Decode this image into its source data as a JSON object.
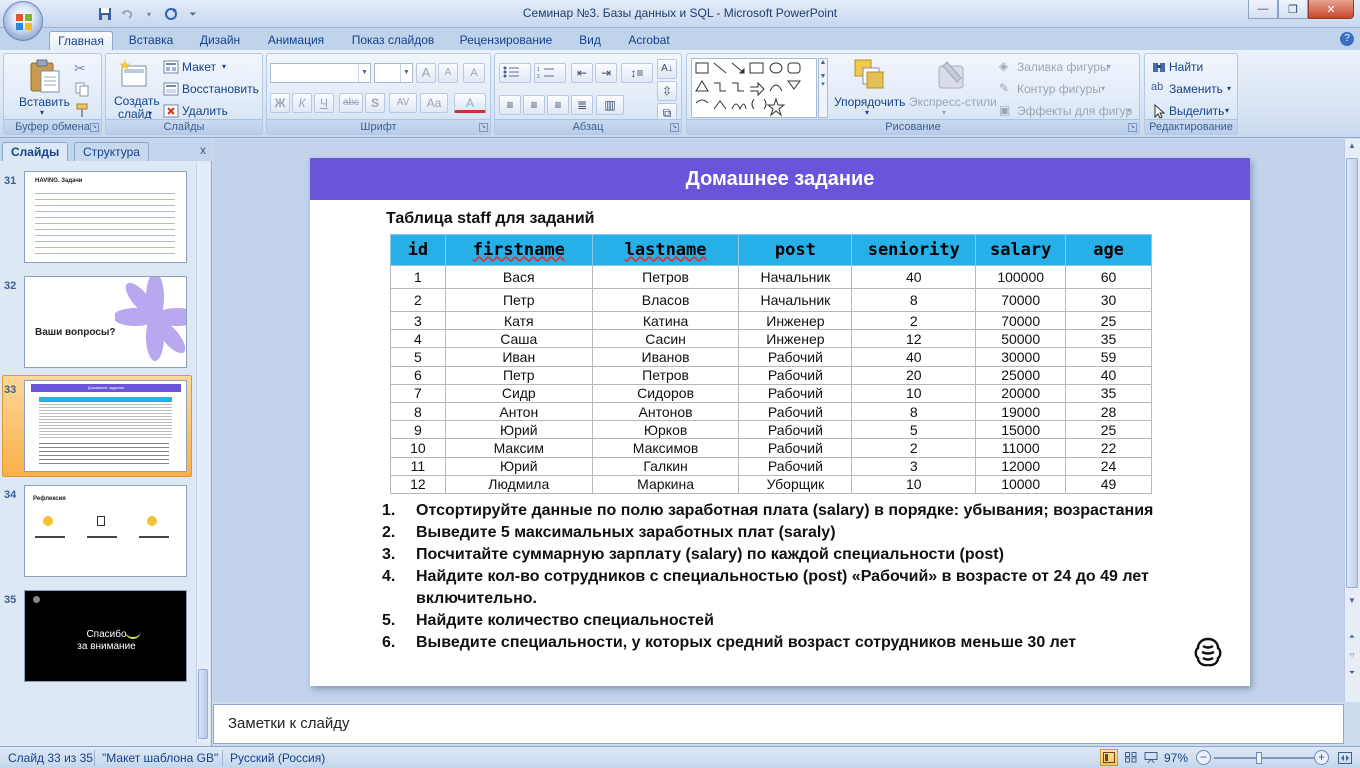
{
  "window": {
    "title": "Семинар №3. Базы данных и SQL - Microsoft PowerPoint",
    "close_label": "✕",
    "minimize_label": "—",
    "restore_label": "❐"
  },
  "ribbon": {
    "tabs": [
      "Главная",
      "Вставка",
      "Дизайн",
      "Анимация",
      "Показ слайдов",
      "Рецензирование",
      "Вид",
      "Acrobat"
    ],
    "active_tab": "Главная",
    "groups": {
      "clipboard": {
        "label": "Буфер обмена",
        "paste": "Вставить"
      },
      "slides": {
        "label": "Слайды",
        "new_slide_1": "Создать",
        "new_slide_2": "слайд",
        "layout": "Макет",
        "reset": "Восстановить",
        "delete": "Удалить"
      },
      "font": {
        "label": "Шрифт",
        "grow": "A",
        "shrink": "A",
        "clear": "A",
        "bold": "Ж",
        "italic": "К",
        "underline": "Ч",
        "strike": "abc",
        "shadow": "S",
        "spacing": "AV",
        "case": "Aa",
        "color": "A"
      },
      "paragraph": {
        "label": "Абзац"
      },
      "drawing": {
        "label": "Рисование",
        "arrange": "Упорядочить",
        "quick_styles": "Экспресс-стили",
        "fill": "Заливка фигуры",
        "outline": "Контур фигуры",
        "effects": "Эффекты для фигур"
      },
      "editing": {
        "label": "Редактирование",
        "find": "Найти",
        "replace": "Заменить",
        "select": "Выделить"
      }
    }
  },
  "left_pane": {
    "tab_slides": "Слайды",
    "tab_outline": "Структура",
    "close": "x",
    "thumbnails": [
      {
        "num": "31",
        "title": "HAVING. Задачи"
      },
      {
        "num": "32",
        "title": "Ваши вопросы?"
      },
      {
        "num": "33",
        "title": "Домашнее задание"
      },
      {
        "num": "34",
        "title": "Рефлексия"
      },
      {
        "num": "35",
        "title_1": "Спасибо",
        "title_2": "за внимание"
      }
    ]
  },
  "slide": {
    "header": "Домашнее задание",
    "caption": "Таблица staff для заданий",
    "columns": [
      "id",
      "firstname",
      "lastname",
      "post",
      "seniority",
      "salary",
      "age"
    ],
    "rows": [
      [
        "1",
        "Вася",
        "Петров",
        "Начальник",
        "40",
        "100000",
        "60"
      ],
      [
        "2",
        "Петр",
        "Власов",
        "Начальник",
        "8",
        "70000",
        "30"
      ],
      [
        "3",
        "Катя",
        "Катина",
        "Инженер",
        "2",
        "70000",
        "25"
      ],
      [
        "4",
        "Саша",
        "Сасин",
        "Инженер",
        "12",
        "50000",
        "35"
      ],
      [
        "5",
        "Иван",
        "Иванов",
        "Рабочий",
        "40",
        "30000",
        "59"
      ],
      [
        "6",
        "Петр",
        "Петров",
        "Рабочий",
        "20",
        "25000",
        "40"
      ],
      [
        "7",
        "Сидр",
        "Сидоров",
        "Рабочий",
        "10",
        "20000",
        "35"
      ],
      [
        "8",
        "Антон",
        "Антонов",
        "Рабочий",
        "8",
        "19000",
        "28"
      ],
      [
        "9",
        "Юрий",
        "Юрков",
        "Рабочий",
        "5",
        "15000",
        "25"
      ],
      [
        "10",
        "Максим",
        "Максимов",
        "Рабочий",
        "2",
        "11000",
        "22"
      ],
      [
        "11",
        "Юрий",
        "Галкин",
        "Рабочий",
        "3",
        "12000",
        "24"
      ],
      [
        "12",
        "Людмила",
        "Маркина",
        "Уборщик",
        "10",
        "10000",
        "49"
      ]
    ],
    "tasks": [
      {
        "num": "1.",
        "text": "Отсортируйте данные по полю заработная плата (salary) в порядке: убывания; возрастания"
      },
      {
        "num": "2.",
        "text": "Выведите 5 максимальных заработных плат (saraly)"
      },
      {
        "num": "3.",
        "text": "Посчитайте суммарную зарплату (salary) по каждой специальности (post)"
      },
      {
        "num": "4.",
        "text": "Найдите кол-во сотрудников с специальностью (post) «Рабочий» в возрасте от 24 до 49 лет включительно."
      },
      {
        "num": "5.",
        "text": "Найдите количество специальностей"
      },
      {
        "num": "6.",
        "text": "Выведите специальности, у которых средний возраст сотрудников меньше 30 лет"
      }
    ]
  },
  "notes": {
    "placeholder": "Заметки к слайду"
  },
  "status": {
    "slide_counter": "Слайд 33 из 35",
    "template": "\"Макет шаблона GB\"",
    "language": "Русский (Россия)",
    "zoom": "97%",
    "zoom_out": "−",
    "zoom_in": "+"
  },
  "colors": {
    "slide_header": "#6a54d9",
    "table_header": "#27b0e8",
    "selected_thumb": "#f9b04a"
  }
}
